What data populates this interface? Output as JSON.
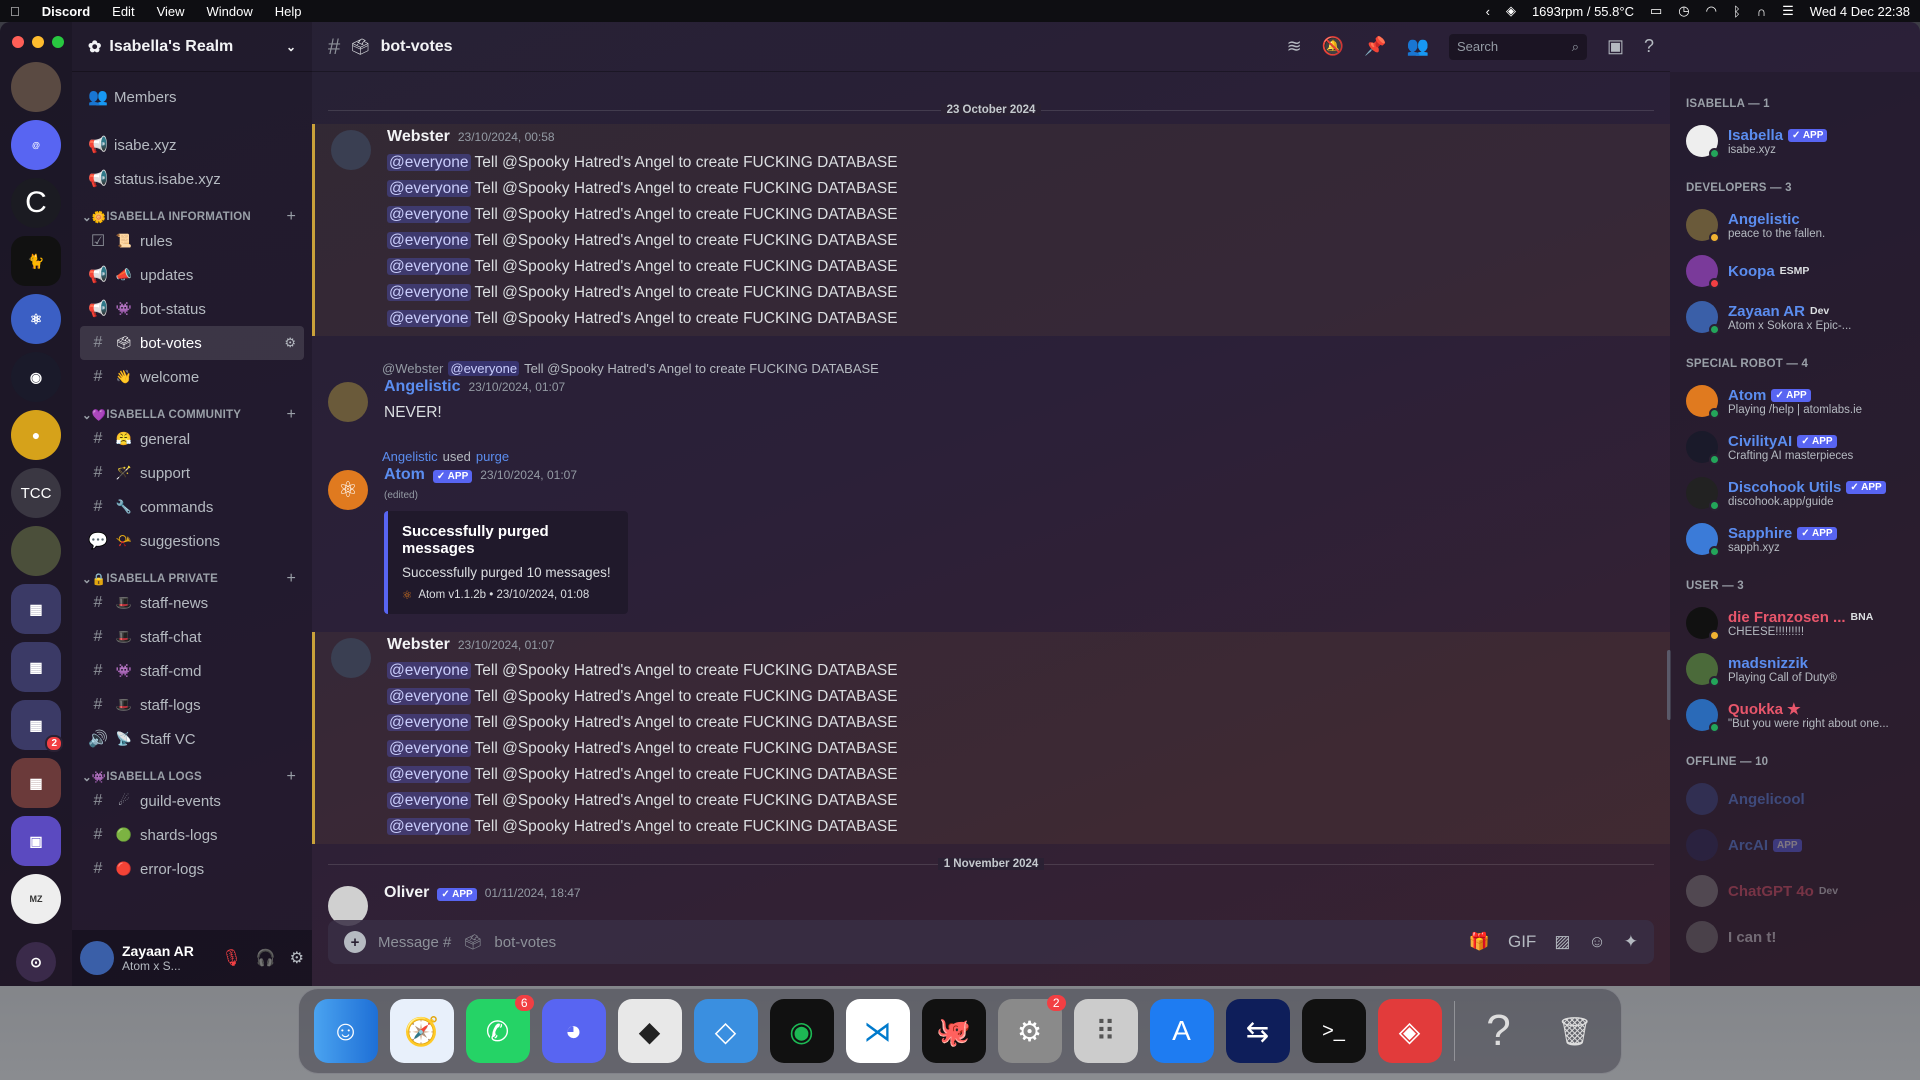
{
  "menubar": {
    "app": "Discord",
    "items": [
      "Edit",
      "View",
      "Window",
      "Help"
    ],
    "status": "1693rpm / 55.8°C",
    "datetime": "Wed 4 Dec  22:38"
  },
  "guild": {
    "name": "Isabella's Realm"
  },
  "channels": {
    "top": [
      {
        "name": "Members"
      },
      {
        "name": "isabe.xyz"
      },
      {
        "name": "status.isabe.xyz"
      }
    ],
    "cat1": "ISABELLA INFORMATION",
    "info": [
      {
        "name": "rules"
      },
      {
        "name": "updates"
      },
      {
        "name": "bot-status"
      },
      {
        "name": "bot-votes"
      },
      {
        "name": "welcome"
      }
    ],
    "cat2": "ISABELLA COMMUNITY",
    "community": [
      {
        "name": "general"
      },
      {
        "name": "support"
      },
      {
        "name": "commands"
      },
      {
        "name": "suggestions"
      }
    ],
    "cat3": "ISABELLA PRIVATE",
    "private": [
      {
        "name": "staff-news"
      },
      {
        "name": "staff-chat"
      },
      {
        "name": "staff-cmd"
      },
      {
        "name": "staff-logs"
      },
      {
        "name": "Staff VC"
      }
    ],
    "cat4": "ISABELLA LOGS",
    "logs": [
      {
        "name": "guild-events"
      },
      {
        "name": "shards-logs"
      },
      {
        "name": "error-logs"
      }
    ]
  },
  "user": {
    "name": "Zayaan AR",
    "status": "Atom x S..."
  },
  "rail": {
    "tcc": "TCC",
    "badge": "2"
  },
  "topbar": {
    "channel": "bot-votes",
    "search": "Search"
  },
  "chat": {
    "divider1": "23 October 2024",
    "divider2": "1 November 2024",
    "mention": "@everyone",
    "spam": "Tell @Spooky Hatred's Angel to create FUCKING DATABASE",
    "msg1": {
      "author": "Webster",
      "time": "23/10/2024, 00:58"
    },
    "msg2": {
      "reply_user": "@Webster",
      "reply_text": "Tell @Spooky Hatred's Angel to create FUCKING DATABASE",
      "author": "Angelistic",
      "time": "23/10/2024, 01:07",
      "text": "NEVER!"
    },
    "msg3": {
      "reply_user": "Angelistic",
      "reply_used": "used",
      "reply_cmd": "purge",
      "author": "Atom",
      "app": "✓ APP",
      "time": "23/10/2024, 01:07",
      "edited": "(edited)",
      "embed_title": "Successfully purged messages",
      "embed_desc": "Successfully purged 10 messages!",
      "embed_footer": "Atom v1.1.2b • 23/10/2024, 01:08"
    },
    "msg4": {
      "author": "Webster",
      "time": "23/10/2024, 01:07"
    },
    "msg5": {
      "author": "Oliver",
      "app": "✓ APP",
      "time": "01/11/2024, 18:47"
    }
  },
  "composer": {
    "placeholder": "Message #",
    "channel": "bot-votes"
  },
  "members": {
    "c1": "ISABELLA — 1",
    "c2": "DEVELOPERS — 3",
    "c3": "SPECIAL ROBOT — 4",
    "c4": "USER — 3",
    "c5": "OFFLINE — 10",
    "app": "✓ APP",
    "isabella": {
      "name": "Isabella",
      "status": "isabe.xyz"
    },
    "devs": [
      {
        "name": "Angelistic",
        "status": "peace to the fallen.",
        "tag": ""
      },
      {
        "name": "Koopa",
        "status": "",
        "tag": "ESMP"
      },
      {
        "name": "Zayaan AR",
        "status": "Atom x Sokora x Epic-...",
        "tag": "Dev"
      }
    ],
    "bots": [
      {
        "name": "Atom",
        "status": "Playing /help | atomlabs.ie"
      },
      {
        "name": "CivilityAI",
        "status": "Crafting AI masterpieces"
      },
      {
        "name": "Discohook Utils",
        "status": "discohook.app/guide"
      },
      {
        "name": "Sapphire",
        "status": "sapph.xyz"
      }
    ],
    "users": [
      {
        "name": "die Franzosen ...",
        "status": "CHEESE!!!!!!!!!",
        "tag": "BNA"
      },
      {
        "name": "madsnizzik",
        "status": "Playing Call of Duty®",
        "tag": ""
      },
      {
        "name": "Quokka ★",
        "status": "\"But you were right about one...",
        "tag": ""
      }
    ],
    "offline": [
      {
        "name": "Angelicool",
        "tag": ""
      },
      {
        "name": "ArcAI",
        "tag": "APP"
      },
      {
        "name": "ChatGPT 4o",
        "tag": "Dev"
      },
      {
        "name": "I can t!",
        "tag": ""
      }
    ]
  },
  "dock": {
    "whatsapp_badge": "6",
    "settings_badge": "2"
  },
  "colors": {
    "accent": "#5865f2",
    "blurple_name": "#5b8def",
    "online": "#23a55a"
  }
}
